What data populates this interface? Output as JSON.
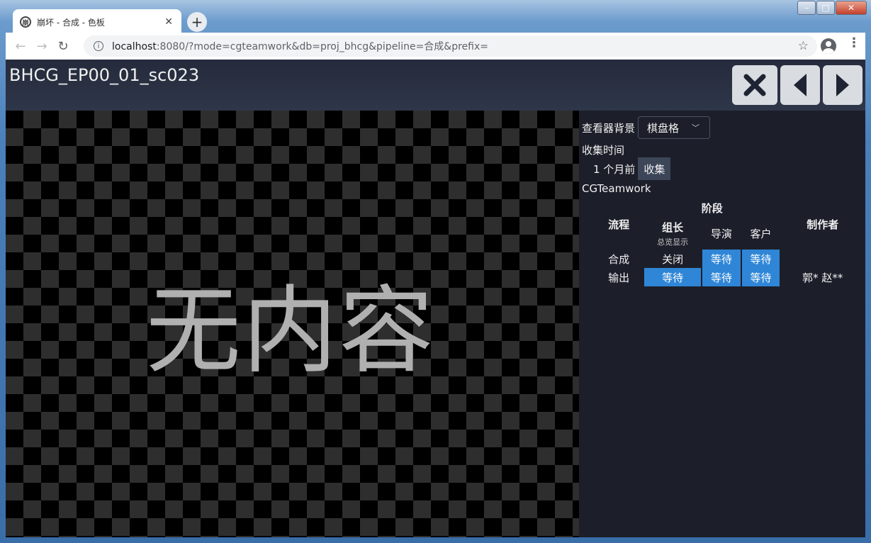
{
  "browser": {
    "tab_title": "崩坏 - 合成 - 色板",
    "tab_favicon": "崩",
    "url_host": "localhost",
    "url_rest": ":8080/?mode=cgteamwork&db=proj_bhcg&pipeline=合成&prefix="
  },
  "page": {
    "title": "BHCG_EP00_01_sc023",
    "viewer_placeholder": "无内容"
  },
  "panel": {
    "bg_label": "查看器背景",
    "bg_value": "棋盘格",
    "collect_time_label": "收集时间",
    "collect_time_value": "1 个月前",
    "collect_button": "收集",
    "source": "CGTeamwork",
    "table": {
      "stage_header": "阶段",
      "pipeline_header": "流程",
      "lead_header": "组长",
      "lead_sub": "总览显示",
      "director_header": "导演",
      "client_header": "客户",
      "maker_header": "制作者",
      "rows": [
        {
          "pipeline": "合成",
          "lead": "关闭",
          "director": "等待",
          "client": "等待",
          "maker": ""
        },
        {
          "pipeline": "输出",
          "lead": "等待",
          "director": "等待",
          "client": "等待",
          "maker": "郭*  赵**"
        }
      ]
    }
  },
  "colors": {
    "status_wait": "#2f86d6",
    "page_bg": "#1c1f2a"
  }
}
